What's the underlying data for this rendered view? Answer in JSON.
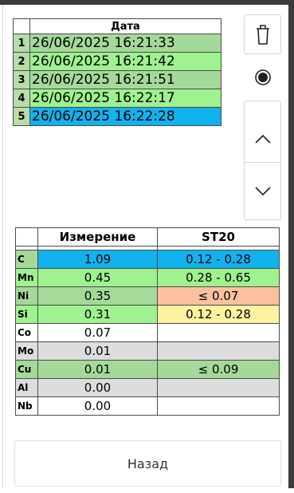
{
  "dates_table": {
    "header": "Дата",
    "rows": [
      {
        "num": "1",
        "date": "26/06/2025 16:21:33",
        "color": "#a5d99a"
      },
      {
        "num": "2",
        "date": "26/06/2025 16:21:42",
        "color": "#9ef28f"
      },
      {
        "num": "3",
        "date": "26/06/2025 16:21:51",
        "color": "#a5d99a"
      },
      {
        "num": "4",
        "date": "26/06/2025 16:22:17",
        "color": "#9ef28f"
      },
      {
        "num": "5",
        "date": "26/06/2025 16:22:28",
        "color": "#11b2ee"
      }
    ]
  },
  "side_buttons": {
    "delete": "trash-icon",
    "record": "record-icon",
    "up": "chevron-up-icon",
    "down": "chevron-down-icon"
  },
  "measurements": {
    "headers": {
      "element": "",
      "measurement": "Измерение",
      "standard": "ST20"
    },
    "rows": [
      {
        "el": "C",
        "val": "1.09",
        "range": "0.12 - 0.28",
        "el_bg": "#a5d99a",
        "val_bg": "#11b2ee",
        "range_bg": "#11b2ee"
      },
      {
        "el": "Mn",
        "val": "0.45",
        "range": "0.28 - 0.65",
        "el_bg": "#9ef28f",
        "val_bg": "#9ef28f",
        "range_bg": "#9ef28f"
      },
      {
        "el": "Ni",
        "val": "0.35",
        "range": "≤ 0.07",
        "el_bg": "#a5d99a",
        "val_bg": "#a5d99a",
        "range_bg": "#fbc19e"
      },
      {
        "el": "Si",
        "val": "0.31",
        "range": "0.12 - 0.28",
        "el_bg": "#9ef28f",
        "val_bg": "#9ef28f",
        "range_bg": "#fdf2a0"
      },
      {
        "el": "Co",
        "val": "0.07",
        "range": "",
        "el_bg": "#ffffff",
        "val_bg": "#ffffff",
        "range_bg": "#ffffff"
      },
      {
        "el": "Mo",
        "val": "0.01",
        "range": "",
        "el_bg": "#dddddd",
        "val_bg": "#dddddd",
        "range_bg": "#dddddd"
      },
      {
        "el": "Cu",
        "val": "0.01",
        "range": "≤ 0.09",
        "el_bg": "#a5d99a",
        "val_bg": "#a5d99a",
        "range_bg": "#a5d99a"
      },
      {
        "el": "Al",
        "val": "0.00",
        "range": "",
        "el_bg": "#dddddd",
        "val_bg": "#dddddd",
        "range_bg": "#dddddd"
      },
      {
        "el": "Nb",
        "val": "0.00",
        "range": "",
        "el_bg": "#ffffff",
        "val_bg": "#ffffff",
        "range_bg": "#ffffff"
      }
    ]
  },
  "back_button": {
    "label": "Назад"
  }
}
